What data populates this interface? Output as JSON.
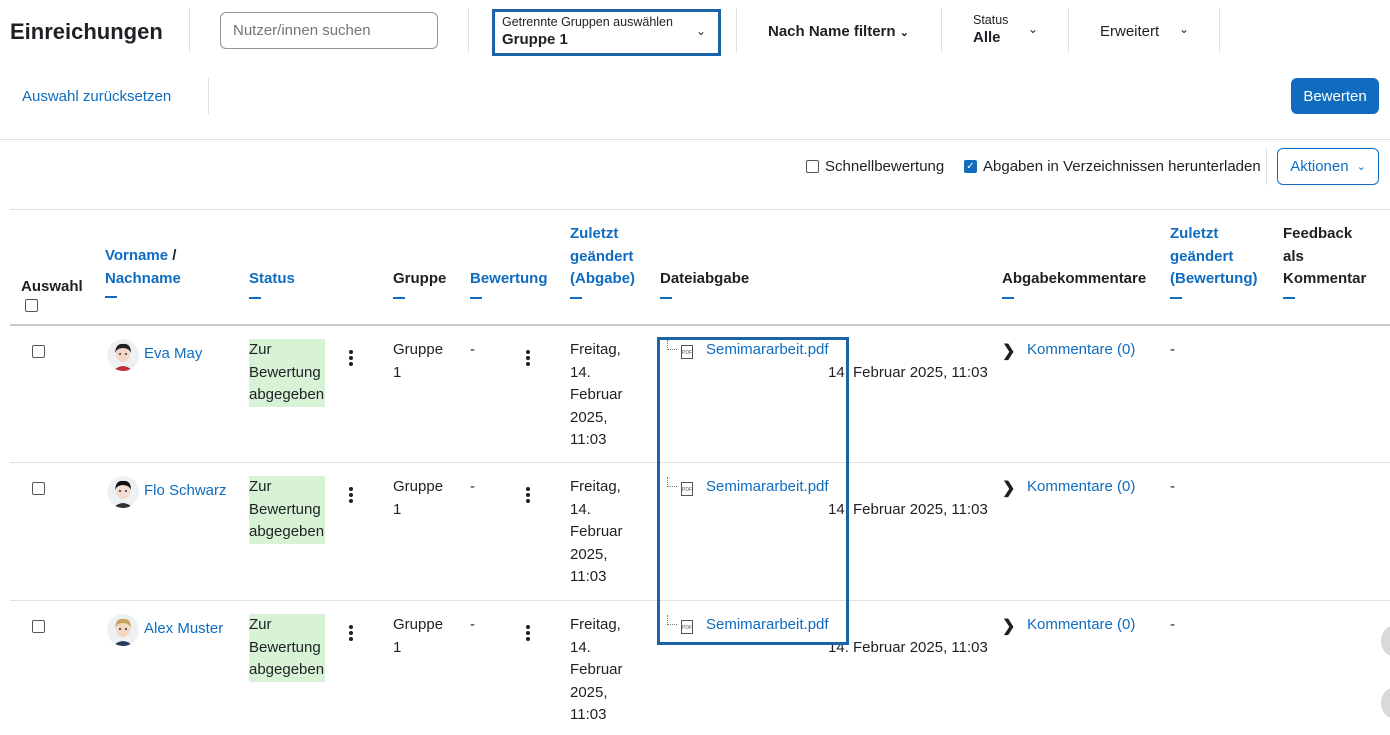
{
  "header": {
    "title": "Einreichungen",
    "search_placeholder": "Nutzer/innen suchen",
    "group_label": "Getrennte Gruppen auswählen",
    "group_value": "Gruppe 1",
    "name_filter": "Nach Name filtern",
    "status_label": "Status",
    "status_value": "Alle",
    "advanced": "Erweitert",
    "reset": "Auswahl zurücksetzen",
    "grade_button": "Bewerten"
  },
  "options": {
    "quick_grading": "Schnellbewertung",
    "quick_grading_checked": false,
    "download_folders": "Abgaben in Verzeichnissen herunterladen",
    "download_folders_checked": true,
    "actions": "Aktionen"
  },
  "columns": {
    "select": "Auswahl",
    "firstname": "Vorname",
    "slash": "/",
    "lastname": "Nachname",
    "status": "Status",
    "group": "Gruppe",
    "grade": "Bewertung",
    "modified_line1": "Zuletzt",
    "modified_line2": "geändert",
    "modified_line3": "(Abgabe)",
    "file": "Dateiabgabe",
    "comments": "Abgabekommentare",
    "grade_modified_line1": "Zuletzt",
    "grade_modified_line2": "geändert",
    "grade_modified_line3": "(Bewertung)",
    "feedback_line1": "Feedback",
    "feedback_line2": "als",
    "feedback_line3": "Kommentar"
  },
  "rows": [
    {
      "name": "Eva May",
      "status_lines": [
        "Zur",
        "Bewertung",
        "abgegeben"
      ],
      "group_lines": [
        "Gruppe",
        "1"
      ],
      "grade": "-",
      "modified_lines": [
        "Freitag,",
        "14.",
        "Februar",
        "2025,",
        "11:03"
      ],
      "file": "Semimararbeit.pdf",
      "file_date": "14. Februar 2025, 11:03",
      "comments": "Kommentare (0)",
      "grade_modified": "-"
    },
    {
      "name": "Flo Schwarz",
      "status_lines": [
        "Zur",
        "Bewertung",
        "abgegeben"
      ],
      "group_lines": [
        "Gruppe",
        "1"
      ],
      "grade": "-",
      "modified_lines": [
        "Freitag,",
        "14.",
        "Februar",
        "2025,",
        "11:03"
      ],
      "file": "Semimararbeit.pdf",
      "file_date": "14. Februar 2025, 11:03",
      "comments": "Kommentare (0)",
      "grade_modified": "-"
    },
    {
      "name": "Alex Muster",
      "status_lines": [
        "Zur",
        "Bewertung",
        "abgegeben"
      ],
      "group_lines": [
        "Gruppe",
        "1"
      ],
      "grade": "-",
      "modified_lines": [
        "Freitag,",
        "14.",
        "Februar",
        "2025,",
        "11:03"
      ],
      "file": "Semimararbeit.pdf",
      "file_date": "14. Februar 2025, 11:03",
      "comments": "Kommentare (0)",
      "grade_modified": "-"
    }
  ],
  "colors": {
    "link": "#0f6cbf",
    "status_bg": "#d7f2d5",
    "highlight": "#1a63a8"
  }
}
